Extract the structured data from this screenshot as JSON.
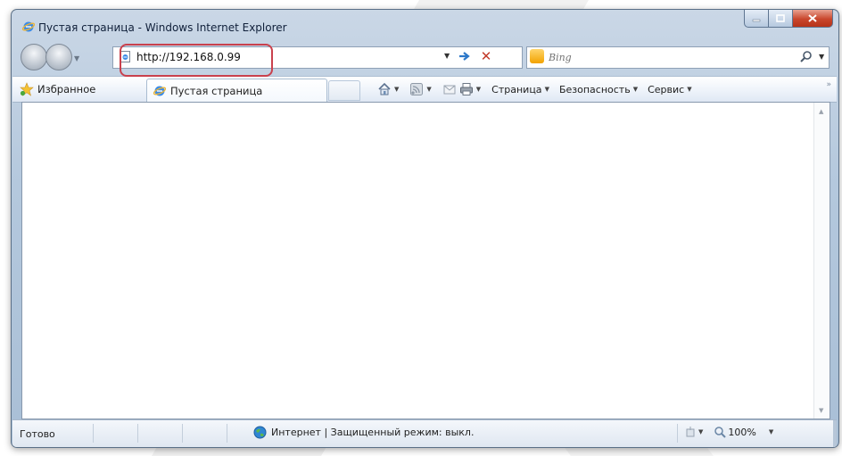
{
  "window": {
    "title": "Пустая страница - Windows Internet Explorer",
    "caption_buttons": [
      "minimize",
      "maximize",
      "close"
    ]
  },
  "nav": {
    "address": "http://192.168.0.99",
    "address_icon": "ie-page-icon",
    "search_placeholder": "Bing",
    "search_provider_icon": "bing-icon"
  },
  "highlight_color": "#c9414d",
  "commandbar": {
    "favorites_label": "Избранное",
    "tab_label": "Пустая страница",
    "menus": [
      "Страница",
      "Безопасность",
      "Сервис"
    ],
    "tool_icons": [
      "home-icon",
      "feeds-icon",
      "read-mail-icon",
      "print-icon"
    ]
  },
  "status": {
    "ready": "Готово",
    "zone": "Интернет | Защищенный режим: выкл.",
    "zoom": "100%"
  }
}
